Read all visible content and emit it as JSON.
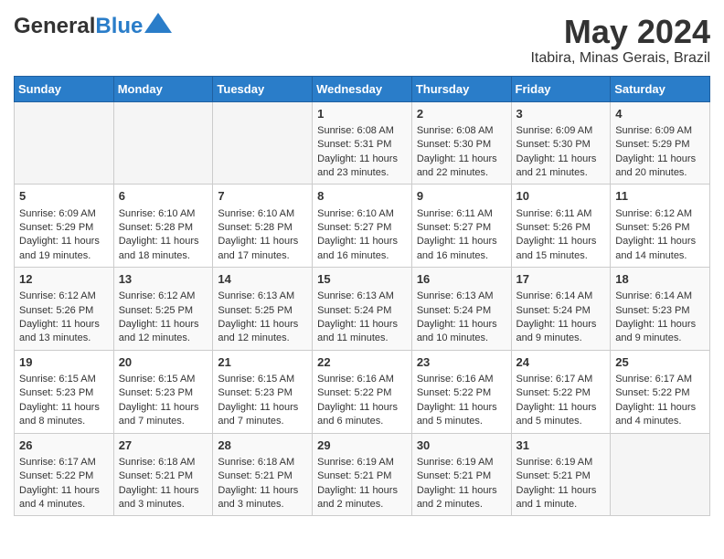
{
  "header": {
    "logo_general": "General",
    "logo_blue": "Blue",
    "month_year": "May 2024",
    "location": "Itabira, Minas Gerais, Brazil"
  },
  "days_of_week": [
    "Sunday",
    "Monday",
    "Tuesday",
    "Wednesday",
    "Thursday",
    "Friday",
    "Saturday"
  ],
  "weeks": [
    [
      {
        "day": "",
        "info": ""
      },
      {
        "day": "",
        "info": ""
      },
      {
        "day": "",
        "info": ""
      },
      {
        "day": "1",
        "info": "Sunrise: 6:08 AM\nSunset: 5:31 PM\nDaylight: 11 hours and 23 minutes."
      },
      {
        "day": "2",
        "info": "Sunrise: 6:08 AM\nSunset: 5:30 PM\nDaylight: 11 hours and 22 minutes."
      },
      {
        "day": "3",
        "info": "Sunrise: 6:09 AM\nSunset: 5:30 PM\nDaylight: 11 hours and 21 minutes."
      },
      {
        "day": "4",
        "info": "Sunrise: 6:09 AM\nSunset: 5:29 PM\nDaylight: 11 hours and 20 minutes."
      }
    ],
    [
      {
        "day": "5",
        "info": "Sunrise: 6:09 AM\nSunset: 5:29 PM\nDaylight: 11 hours and 19 minutes."
      },
      {
        "day": "6",
        "info": "Sunrise: 6:10 AM\nSunset: 5:28 PM\nDaylight: 11 hours and 18 minutes."
      },
      {
        "day": "7",
        "info": "Sunrise: 6:10 AM\nSunset: 5:28 PM\nDaylight: 11 hours and 17 minutes."
      },
      {
        "day": "8",
        "info": "Sunrise: 6:10 AM\nSunset: 5:27 PM\nDaylight: 11 hours and 16 minutes."
      },
      {
        "day": "9",
        "info": "Sunrise: 6:11 AM\nSunset: 5:27 PM\nDaylight: 11 hours and 16 minutes."
      },
      {
        "day": "10",
        "info": "Sunrise: 6:11 AM\nSunset: 5:26 PM\nDaylight: 11 hours and 15 minutes."
      },
      {
        "day": "11",
        "info": "Sunrise: 6:12 AM\nSunset: 5:26 PM\nDaylight: 11 hours and 14 minutes."
      }
    ],
    [
      {
        "day": "12",
        "info": "Sunrise: 6:12 AM\nSunset: 5:26 PM\nDaylight: 11 hours and 13 minutes."
      },
      {
        "day": "13",
        "info": "Sunrise: 6:12 AM\nSunset: 5:25 PM\nDaylight: 11 hours and 12 minutes."
      },
      {
        "day": "14",
        "info": "Sunrise: 6:13 AM\nSunset: 5:25 PM\nDaylight: 11 hours and 12 minutes."
      },
      {
        "day": "15",
        "info": "Sunrise: 6:13 AM\nSunset: 5:24 PM\nDaylight: 11 hours and 11 minutes."
      },
      {
        "day": "16",
        "info": "Sunrise: 6:13 AM\nSunset: 5:24 PM\nDaylight: 11 hours and 10 minutes."
      },
      {
        "day": "17",
        "info": "Sunrise: 6:14 AM\nSunset: 5:24 PM\nDaylight: 11 hours and 9 minutes."
      },
      {
        "day": "18",
        "info": "Sunrise: 6:14 AM\nSunset: 5:23 PM\nDaylight: 11 hours and 9 minutes."
      }
    ],
    [
      {
        "day": "19",
        "info": "Sunrise: 6:15 AM\nSunset: 5:23 PM\nDaylight: 11 hours and 8 minutes."
      },
      {
        "day": "20",
        "info": "Sunrise: 6:15 AM\nSunset: 5:23 PM\nDaylight: 11 hours and 7 minutes."
      },
      {
        "day": "21",
        "info": "Sunrise: 6:15 AM\nSunset: 5:23 PM\nDaylight: 11 hours and 7 minutes."
      },
      {
        "day": "22",
        "info": "Sunrise: 6:16 AM\nSunset: 5:22 PM\nDaylight: 11 hours and 6 minutes."
      },
      {
        "day": "23",
        "info": "Sunrise: 6:16 AM\nSunset: 5:22 PM\nDaylight: 11 hours and 5 minutes."
      },
      {
        "day": "24",
        "info": "Sunrise: 6:17 AM\nSunset: 5:22 PM\nDaylight: 11 hours and 5 minutes."
      },
      {
        "day": "25",
        "info": "Sunrise: 6:17 AM\nSunset: 5:22 PM\nDaylight: 11 hours and 4 minutes."
      }
    ],
    [
      {
        "day": "26",
        "info": "Sunrise: 6:17 AM\nSunset: 5:22 PM\nDaylight: 11 hours and 4 minutes."
      },
      {
        "day": "27",
        "info": "Sunrise: 6:18 AM\nSunset: 5:21 PM\nDaylight: 11 hours and 3 minutes."
      },
      {
        "day": "28",
        "info": "Sunrise: 6:18 AM\nSunset: 5:21 PM\nDaylight: 11 hours and 3 minutes."
      },
      {
        "day": "29",
        "info": "Sunrise: 6:19 AM\nSunset: 5:21 PM\nDaylight: 11 hours and 2 minutes."
      },
      {
        "day": "30",
        "info": "Sunrise: 6:19 AM\nSunset: 5:21 PM\nDaylight: 11 hours and 2 minutes."
      },
      {
        "day": "31",
        "info": "Sunrise: 6:19 AM\nSunset: 5:21 PM\nDaylight: 11 hours and 1 minute."
      },
      {
        "day": "",
        "info": ""
      }
    ]
  ]
}
